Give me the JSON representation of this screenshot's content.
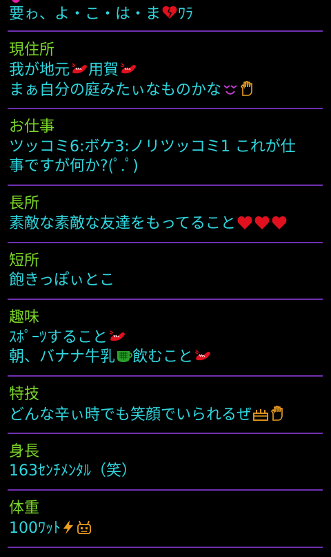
{
  "header_line": "要ゎ、よ・こ・は・ま",
  "header_suffix": "ﾜﾗ",
  "sections": [
    {
      "label": "現住所",
      "lines": [
        {
          "parts": [
            "我が地元",
            "用賀"
          ]
        },
        {
          "parts": [
            "まぁ自分の庭みたぃなものかな"
          ]
        }
      ]
    },
    {
      "label": "お仕事",
      "lines": [
        {
          "parts": [
            "ツッコミ6:ボケ3:ノリツッコミ1 これが仕"
          ]
        },
        {
          "parts": [
            "事ですが何か?(ﾟ.ﾟ)"
          ]
        }
      ]
    },
    {
      "label": "長所",
      "lines": [
        {
          "parts": [
            "素敵な素敵な友達をもってること"
          ]
        }
      ]
    },
    {
      "label": "短所",
      "lines": [
        {
          "parts": [
            "飽きっぽぃとこ"
          ]
        }
      ]
    },
    {
      "label": "趣味",
      "lines": [
        {
          "parts": [
            "ｽﾎﾟｰﾂすること"
          ]
        },
        {
          "parts": [
            "朝、バナナ牛乳",
            "飲むこと"
          ]
        }
      ]
    },
    {
      "label": "特技",
      "lines": [
        {
          "parts": [
            "どんな辛ぃ時でも笑顔でいられるぜ"
          ]
        }
      ]
    },
    {
      "label": "身長",
      "lines": [
        {
          "parts": [
            "163ｾﾝﾁﾒﾝﾀﾙ（笑）"
          ]
        }
      ]
    },
    {
      "label": "体重",
      "lines": [
        {
          "parts": [
            "100ﾜｯﾄ"
          ]
        }
      ]
    }
  ],
  "icons": {
    "heart_color": "#e0101e",
    "shoe_color": "#e0101e",
    "hand_color": "#f0a020",
    "smile_color": "#c040d0",
    "cup_color": "#2aa02a",
    "bolt_color": "#f0a020",
    "robot_color": "#f0a020"
  },
  "colors": {
    "label": "#7bd62a",
    "text": "#2fd6de",
    "divider": "#6f2fb0",
    "background": "#000000"
  }
}
